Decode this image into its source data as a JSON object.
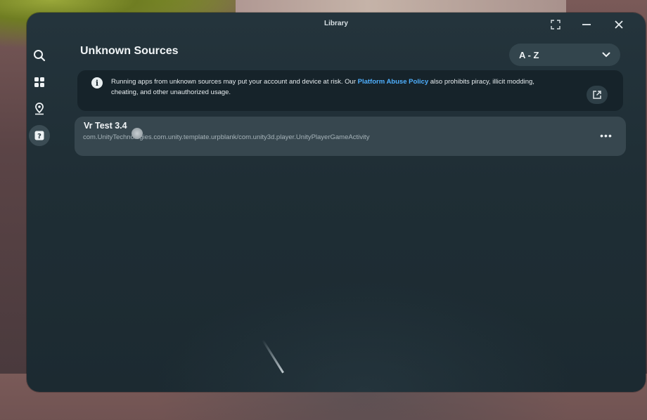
{
  "window": {
    "title": "Library"
  },
  "titlebar": {
    "maximize_icon": "expand-icon",
    "minimize_icon": "minimize-icon",
    "close_icon": "close-icon"
  },
  "sidebar": {
    "items": [
      {
        "icon": "search-icon",
        "active": false
      },
      {
        "icon": "apps-grid-icon",
        "active": false
      },
      {
        "icon": "location-pin-icon",
        "active": false
      },
      {
        "icon": "unknown-sources-icon",
        "active": true
      }
    ]
  },
  "main": {
    "title": "Unknown Sources",
    "sort": {
      "selected": "A - Z"
    },
    "notice": {
      "text_before": "Running apps from unknown sources may put your account and device at risk. Our ",
      "link": "Platform Abuse Policy",
      "text_after": " also prohibits piracy, illicit modding, cheating, and other unauthorized usage."
    },
    "apps": [
      {
        "name": "Vr Test 3.4",
        "package": "com.UnityTechnologies.com.unity.template.urpblank/com.unity3d.player.UnityPlayerGameActivity",
        "more": "•••"
      }
    ]
  },
  "colors": {
    "panel": "#1f2e35",
    "accent_link": "#4fb0ff",
    "row": "#37474f"
  }
}
